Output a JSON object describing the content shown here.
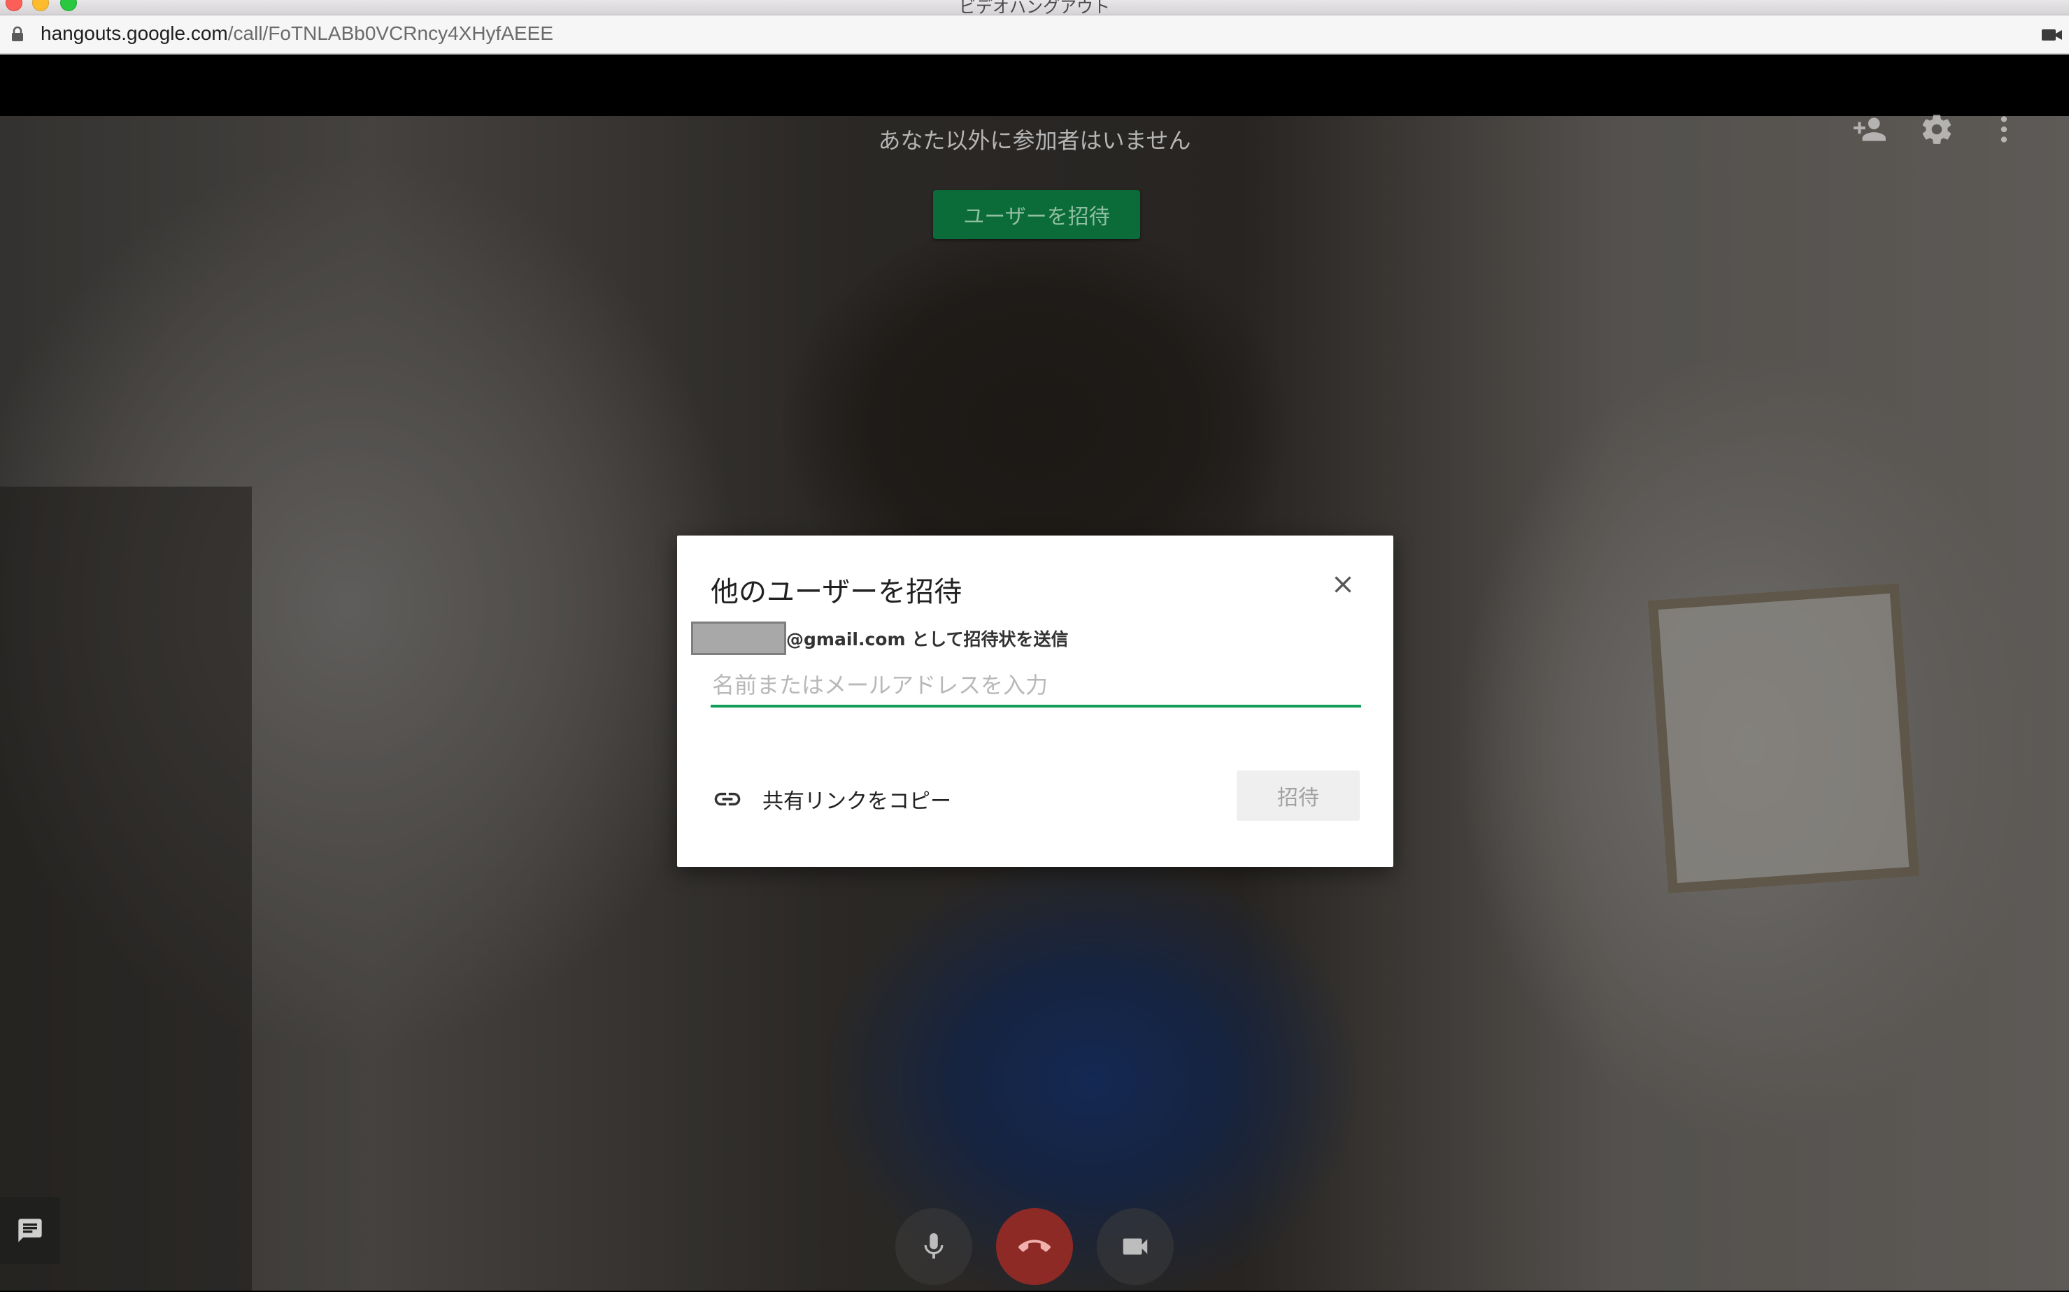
{
  "window": {
    "title": "ビデオハングアウト"
  },
  "browser": {
    "url_host": "hangouts.google.com",
    "url_path": "/call/FoTNLABb0VCRncy4XHyfAEEE",
    "lock_icon": "lock-icon",
    "camera_indicator_icon": "camera-indicator-icon"
  },
  "call": {
    "no_participants_text": "あなた以外に参加者はいません",
    "invite_users_button": "ユーザーを招待",
    "top_icons": [
      "add-person-icon",
      "settings-gear-icon",
      "more-vert-icon"
    ],
    "controls": {
      "mic_icon": "microphone-icon",
      "hangup_icon": "hangup-phone-icon",
      "camera_icon": "video-camera-icon",
      "chat_icon": "chat-icon"
    },
    "colors": {
      "invite_button_bg": "#0b6b39",
      "hangup_bg": "#8e2a25",
      "input_underline": "#0f9d58"
    }
  },
  "dialog": {
    "title": "他のユーザーを招待",
    "sender_suffix": "@gmail.com として招待状を送信",
    "input_placeholder": "名前またはメールアドレスを入力",
    "copy_link_label": "共有リンクをコピー",
    "invite_button": "招待",
    "close_icon": "close-icon",
    "link_icon": "link-icon"
  }
}
